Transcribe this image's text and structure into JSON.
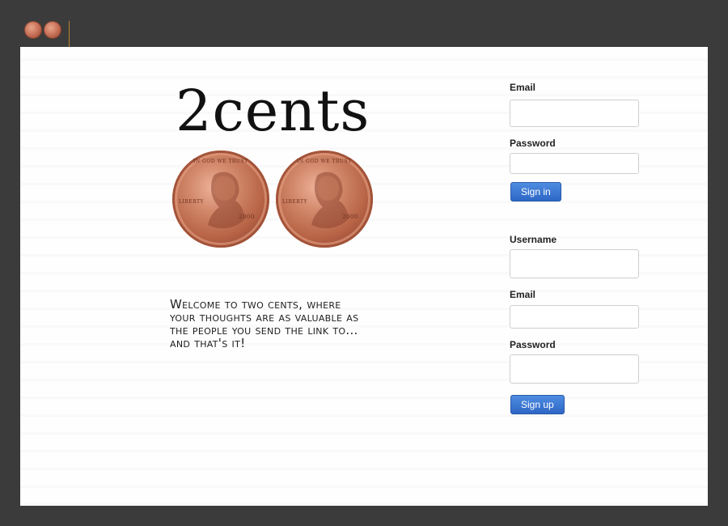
{
  "brand": {
    "title": "2cents",
    "coin_year": "2000",
    "coin_motto": "IN GOD WE TRUST",
    "coin_liberty": "LIBERTY"
  },
  "welcome": {
    "text": "Welcome to two cents, where your thoughts are as valuable as the people you send the link to... and that's it!"
  },
  "signin": {
    "email_label": "Email",
    "password_label": "Password",
    "button_label": "Sign in"
  },
  "signup": {
    "username_label": "Username",
    "email_label": "Email",
    "password_label": "Password",
    "button_label": "Sign up"
  },
  "colors": {
    "frame": "#3b3b3b",
    "panel": "#fefefe",
    "button": "#2e67c6",
    "divider": "#b8862e"
  }
}
